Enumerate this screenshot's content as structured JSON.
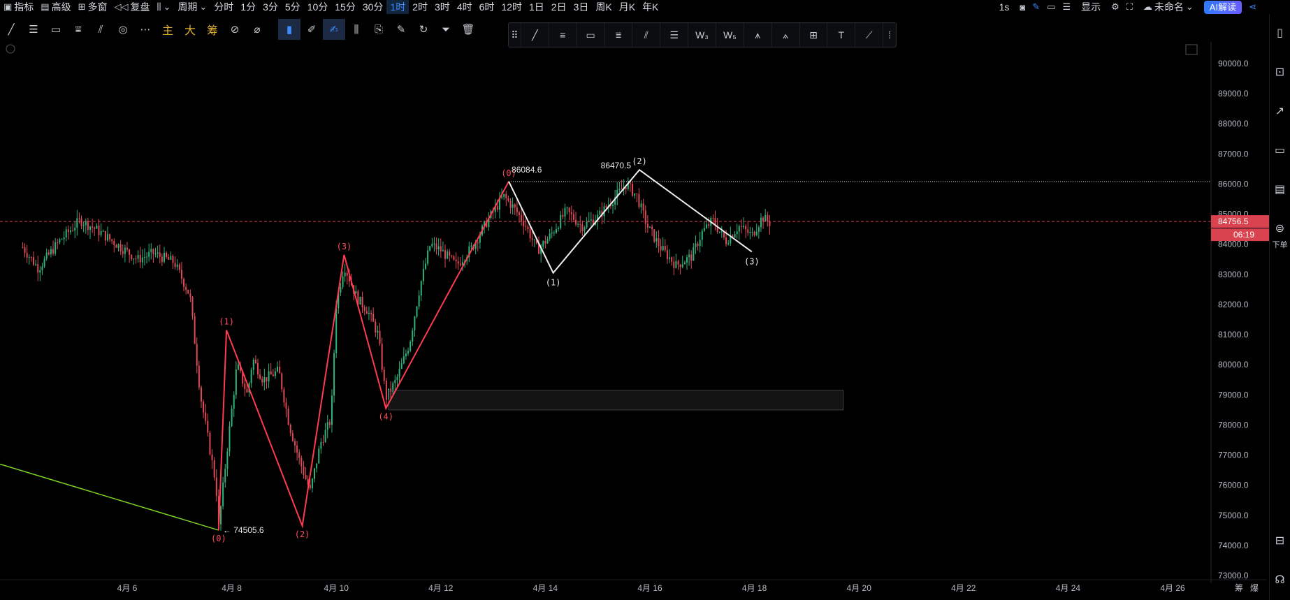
{
  "topbar": {
    "items": [
      "指标",
      "高级",
      "多窗",
      "复盘",
      "",
      "周期",
      "分时",
      "1分",
      "3分",
      "5分",
      "10分",
      "15分",
      "30分",
      "1时",
      "2时",
      "3时",
      "4时",
      "6时",
      "12时",
      "1日",
      "2日",
      "3日",
      "周K",
      "月K",
      "年K"
    ],
    "active_index": 13,
    "right": {
      "interval": "1s",
      "display_label": "显示",
      "layout_name": "未命名",
      "ai_button": "AI解读"
    }
  },
  "toolbar": {
    "labels": [
      "主",
      "大",
      "筹"
    ]
  },
  "sidebar": {
    "order_label": "下单"
  },
  "price_tags": {
    "last_price": "84756.5",
    "countdown": "06:19"
  },
  "chart_data": {
    "type": "candlestick",
    "yaxis": {
      "min": 73000,
      "max": 90000,
      "step": 1000,
      "ticks": [
        "73000.0",
        "74000.0",
        "75000.0",
        "76000.0",
        "77000.0",
        "78000.0",
        "79000.0",
        "80000.0",
        "81000.0",
        "82000.0",
        "83000.0",
        "84000.0",
        "85000.0",
        "86000.0",
        "87000.0",
        "88000.0",
        "89000.0",
        "90000.0"
      ]
    },
    "xaxis": {
      "ticks": [
        "4月 6",
        "4月 8",
        "4月 10",
        "4月 12",
        "4月 14",
        "4月 16",
        "4月 18",
        "4月 20",
        "4月 22",
        "4月 24",
        "4月 26"
      ],
      "right_labels": [
        "筹",
        "爆"
      ]
    },
    "price_path": [
      {
        "d": 4.0,
        "p": 83900
      },
      {
        "d": 4.3,
        "p": 83200
      },
      {
        "d": 4.7,
        "p": 84100
      },
      {
        "d": 5.1,
        "p": 84800
      },
      {
        "d": 5.4,
        "p": 84500
      },
      {
        "d": 5.8,
        "p": 84000
      },
      {
        "d": 6.2,
        "p": 83500
      },
      {
        "d": 6.5,
        "p": 83700
      },
      {
        "d": 6.9,
        "p": 83400
      },
      {
        "d": 7.2,
        "p": 82300
      },
      {
        "d": 7.4,
        "p": 79000
      },
      {
        "d": 7.7,
        "p": 76000
      },
      {
        "d": 7.75,
        "p": 74600
      },
      {
        "d": 7.9,
        "p": 77000
      },
      {
        "d": 8.0,
        "p": 78500
      },
      {
        "d": 8.1,
        "p": 80000
      },
      {
        "d": 8.3,
        "p": 79000
      },
      {
        "d": 8.4,
        "p": 80200
      },
      {
        "d": 8.6,
        "p": 79500
      },
      {
        "d": 8.9,
        "p": 79800
      },
      {
        "d": 9.1,
        "p": 78000
      },
      {
        "d": 9.3,
        "p": 76800
      },
      {
        "d": 9.5,
        "p": 75800
      },
      {
        "d": 9.7,
        "p": 77400
      },
      {
        "d": 9.9,
        "p": 78200
      },
      {
        "d": 10.0,
        "p": 82000
      },
      {
        "d": 10.15,
        "p": 83300
      },
      {
        "d": 10.4,
        "p": 82200
      },
      {
        "d": 10.6,
        "p": 81800
      },
      {
        "d": 10.8,
        "p": 81000
      },
      {
        "d": 10.95,
        "p": 78900
      },
      {
        "d": 11.15,
        "p": 79500
      },
      {
        "d": 11.4,
        "p": 80700
      },
      {
        "d": 11.6,
        "p": 82600
      },
      {
        "d": 11.8,
        "p": 84000
      },
      {
        "d": 12.0,
        "p": 83800
      },
      {
        "d": 12.3,
        "p": 83300
      },
      {
        "d": 12.6,
        "p": 83900
      },
      {
        "d": 12.9,
        "p": 84800
      },
      {
        "d": 13.2,
        "p": 85600
      },
      {
        "d": 13.4,
        "p": 85200
      },
      {
        "d": 13.6,
        "p": 84700
      },
      {
        "d": 13.85,
        "p": 83800
      },
      {
        "d": 14.1,
        "p": 84300
      },
      {
        "d": 14.4,
        "p": 85100
      },
      {
        "d": 14.7,
        "p": 84600
      },
      {
        "d": 15.0,
        "p": 84900
      },
      {
        "d": 15.3,
        "p": 85500
      },
      {
        "d": 15.55,
        "p": 86000
      },
      {
        "d": 15.75,
        "p": 85600
      },
      {
        "d": 15.95,
        "p": 84600
      },
      {
        "d": 16.2,
        "p": 83900
      },
      {
        "d": 16.5,
        "p": 83300
      },
      {
        "d": 16.8,
        "p": 83600
      },
      {
        "d": 17.0,
        "p": 84400
      },
      {
        "d": 17.2,
        "p": 84800
      },
      {
        "d": 17.45,
        "p": 84100
      },
      {
        "d": 17.7,
        "p": 84600
      },
      {
        "d": 17.95,
        "p": 84300
      },
      {
        "d": 18.15,
        "p": 84900
      },
      {
        "d": 18.3,
        "p": 84700
      }
    ],
    "current_price": 84756.5,
    "dotted_level": 86084.6,
    "red_waves": [
      {
        "label": "(0)",
        "d": 7.75,
        "p": 74505.6
      },
      {
        "label": "(1)",
        "d": 7.9,
        "p": 81150
      },
      {
        "label": "(2)",
        "d": 9.35,
        "p": 74650
      },
      {
        "label": "(3)",
        "d": 10.15,
        "p": 83650
      },
      {
        "label": "(4)",
        "d": 10.95,
        "p": 78550
      },
      {
        "label": "(0)",
        "d": 13.3,
        "p": 86084.6
      }
    ],
    "white_waves": [
      {
        "label": "",
        "d": 13.3,
        "p": 86084.6
      },
      {
        "label": "(1)",
        "d": 14.15,
        "p": 83050
      },
      {
        "label": "(2)",
        "d": 15.8,
        "p": 86470.5
      },
      {
        "label": "(3)",
        "d": 17.95,
        "p": 83750
      }
    ],
    "price_labels": [
      {
        "text": "74505.6",
        "d": 7.75,
        "p": 74505.6
      },
      {
        "text": "86084.6",
        "d": 13.3,
        "p": 86084.6
      },
      {
        "text": "86470.5",
        "d": 15.8,
        "p": 86470.5
      }
    ],
    "box": {
      "d1": 11.0,
      "d2": 19.7,
      "p1": 78500,
      "p2": 79150
    },
    "green_line": {
      "d1": 2.0,
      "p1": 76700,
      "d2": 7.75,
      "p2": 74505.6
    }
  }
}
